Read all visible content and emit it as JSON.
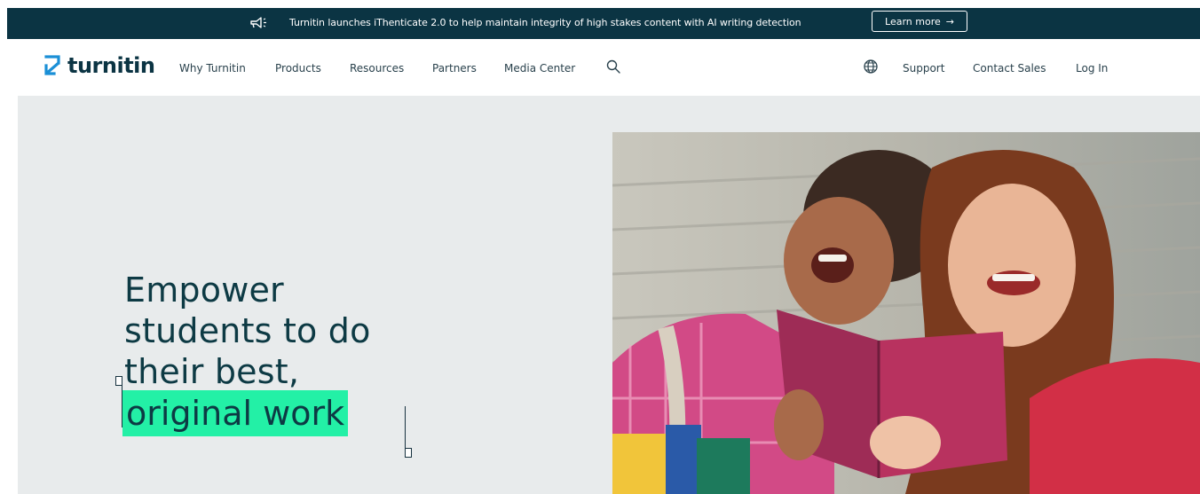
{
  "banner": {
    "icon": "megaphone-icon",
    "text": "Turnitin launches iThenticate 2.0 to help maintain integrity of high stakes content with AI writing detection",
    "cta_label": "Learn more",
    "cta_icon": "arrow-right-icon"
  },
  "header": {
    "logo_text": "turnitin",
    "nav": [
      "Why Turnitin",
      "Products",
      "Resources",
      "Partners",
      "Media Center"
    ],
    "search_icon": "search-icon",
    "globe_icon": "globe-icon",
    "right_links": [
      "Support",
      "Contact Sales",
      "Log In"
    ]
  },
  "hero": {
    "headline_lines": [
      "Empower",
      "students to do",
      "their best,"
    ],
    "highlight": "original work",
    "image": "two-students-laughing-reading-book"
  },
  "colors": {
    "banner_bg": "#0b3443",
    "hero_bg": "#e8ebec",
    "highlight": "#23f0a6",
    "logo_accent": "#1a8fd6",
    "text_dark": "#0d3a44"
  }
}
